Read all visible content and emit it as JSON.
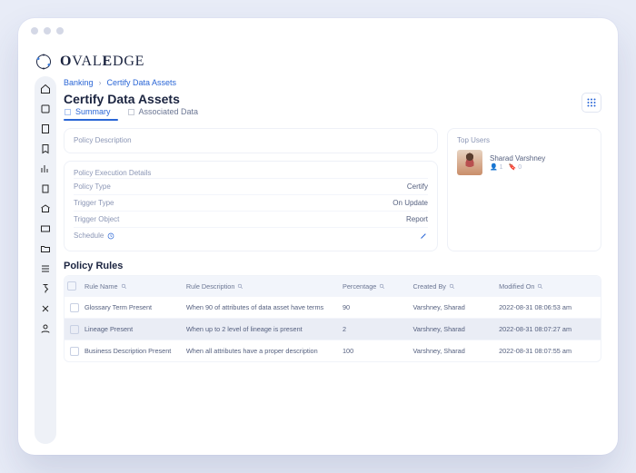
{
  "brand": {
    "name_part1": "O",
    "name_part2": "VAL",
    "name_part3": "E",
    "name_part4": "DGE"
  },
  "breadcrumb": {
    "a": "Banking",
    "b": "Certify Data Assets"
  },
  "page_title": "Certify Data Assets",
  "tabs": {
    "summary": "Summary",
    "associated": "Associated Data"
  },
  "policy_desc_label": "Policy Description",
  "exec_label": "Policy Execution Details",
  "exec": {
    "policy_type": {
      "label": "Policy Type",
      "value": "Certify"
    },
    "trigger_type": {
      "label": "Trigger Type",
      "value": "On Update"
    },
    "trigger_object": {
      "label": "Trigger Object",
      "value": "Report"
    },
    "schedule": {
      "label": "Schedule"
    }
  },
  "top_users": {
    "label": "Top Users",
    "user": {
      "name": "Sharad Varshney",
      "stat1": "1",
      "stat2": "0"
    }
  },
  "rules_title": "Policy Rules",
  "rules": {
    "headers": {
      "name": "Rule Name",
      "desc": "Rule Description",
      "pct": "Percentage",
      "by": "Created By",
      "on": "Modified On"
    },
    "rows": [
      {
        "name": "Glossary Term Present",
        "desc": "When 90 of attributes of data asset have terms",
        "pct": "90",
        "by": "Varshney, Sharad",
        "on": "2022-08-31 08:06:53 am"
      },
      {
        "name": "Lineage Present",
        "desc": "When up to 2 level of lineage is present",
        "pct": "2",
        "by": "Varshney, Sharad",
        "on": "2022-08-31 08:07:27 am"
      },
      {
        "name": "Business Description Present",
        "desc": "When all attributes have a proper description",
        "pct": "100",
        "by": "Varshney, Sharad",
        "on": "2022-08-31 08:07:55 am"
      }
    ]
  }
}
